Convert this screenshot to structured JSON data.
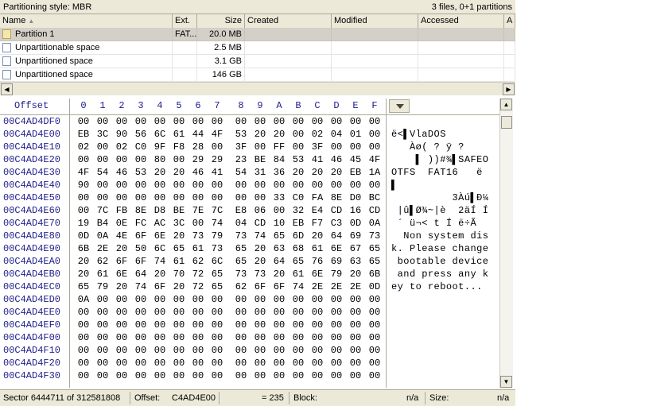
{
  "topbar": {
    "partition_style": "Partitioning style: MBR",
    "summary": "3 files, 0+1 partitions"
  },
  "file_list": {
    "columns": [
      "Name",
      "Ext.",
      "Size",
      "Created",
      "Modified",
      "Accessed",
      "A"
    ],
    "rows": [
      {
        "name": "Partition 1",
        "ext": "FAT...",
        "size": "20.0 MB",
        "icon": "partition-icon",
        "selected": true
      },
      {
        "name": "Unpartitionable space",
        "ext": "",
        "size": "2.5 MB",
        "icon": "document-icon",
        "selected": false
      },
      {
        "name": "Unpartitioned space",
        "ext": "",
        "size": "3.1 GB",
        "icon": "document-icon",
        "selected": false
      },
      {
        "name": "Unpartitioned space",
        "ext": "",
        "size": "146 GB",
        "icon": "document-icon",
        "selected": false
      }
    ]
  },
  "hex_view": {
    "offset_label": "Offset",
    "column_labels": [
      "0",
      "1",
      "2",
      "3",
      "4",
      "5",
      "6",
      "7",
      "8",
      "9",
      "A",
      "B",
      "C",
      "D",
      "E",
      "F"
    ],
    "rows": [
      {
        "offset": "00C4AD4DF0",
        "bytes": [
          "00",
          "00",
          "00",
          "00",
          "00",
          "00",
          "00",
          "00",
          "00",
          "00",
          "00",
          "00",
          "00",
          "00",
          "00",
          "00"
        ],
        "text": ""
      },
      {
        "offset": "00C4AD4E00",
        "bytes": [
          "EB",
          "3C",
          "90",
          "56",
          "6C",
          "61",
          "44",
          "4F",
          "53",
          "20",
          "20",
          "00",
          "02",
          "04",
          "01",
          "00"
        ],
        "text": "ë<▌VlaDOS"
      },
      {
        "offset": "00C4AD4E10",
        "bytes": [
          "02",
          "00",
          "02",
          "C0",
          "9F",
          "F8",
          "28",
          "00",
          "3F",
          "00",
          "FF",
          "00",
          "3F",
          "00",
          "00",
          "00"
        ],
        "text": "   Àø( ? ÿ ?"
      },
      {
        "offset": "00C4AD4E20",
        "bytes": [
          "00",
          "00",
          "00",
          "00",
          "80",
          "00",
          "29",
          "29",
          "23",
          "BE",
          "84",
          "53",
          "41",
          "46",
          "45",
          "4F"
        ],
        "text": "    ▌ ))#¾▌SAFEO"
      },
      {
        "offset": "00C4AD4E30",
        "bytes": [
          "4F",
          "54",
          "46",
          "53",
          "20",
          "20",
          "46",
          "41",
          "54",
          "31",
          "36",
          "20",
          "20",
          "20",
          "EB",
          "1A"
        ],
        "text": "OTFS  FAT16   ë"
      },
      {
        "offset": "00C4AD4E40",
        "bytes": [
          "90",
          "00",
          "00",
          "00",
          "00",
          "00",
          "00",
          "00",
          "00",
          "00",
          "00",
          "00",
          "00",
          "00",
          "00",
          "00"
        ],
        "text": "▌"
      },
      {
        "offset": "00C4AD4E50",
        "bytes": [
          "00",
          "00",
          "00",
          "00",
          "00",
          "00",
          "00",
          "00",
          "00",
          "00",
          "33",
          "C0",
          "FA",
          "8E",
          "D0",
          "BC"
        ],
        "text": "          3Àú▌Ð¼"
      },
      {
        "offset": "00C4AD4E60",
        "bytes": [
          "00",
          "7C",
          "FB",
          "8E",
          "D8",
          "BE",
          "7E",
          "7C",
          "E8",
          "06",
          "00",
          "32",
          "E4",
          "CD",
          "16",
          "CD"
        ],
        "text": " |û▌Ø¾~|è  2äÍ Í"
      },
      {
        "offset": "00C4AD4E70",
        "bytes": [
          "19",
          "B4",
          "0E",
          "FC",
          "AC",
          "3C",
          "00",
          "74",
          "04",
          "CD",
          "10",
          "EB",
          "F7",
          "C3",
          "0D",
          "0A"
        ],
        "text": " ´ ü¬< t Í ë÷Ã"
      },
      {
        "offset": "00C4AD4E80",
        "bytes": [
          "0D",
          "0A",
          "4E",
          "6F",
          "6E",
          "20",
          "73",
          "79",
          "73",
          "74",
          "65",
          "6D",
          "20",
          "64",
          "69",
          "73"
        ],
        "text": "  Non system dis"
      },
      {
        "offset": "00C4AD4E90",
        "bytes": [
          "6B",
          "2E",
          "20",
          "50",
          "6C",
          "65",
          "61",
          "73",
          "65",
          "20",
          "63",
          "68",
          "61",
          "6E",
          "67",
          "65"
        ],
        "text": "k. Please change"
      },
      {
        "offset": "00C4AD4EA0",
        "bytes": [
          "20",
          "62",
          "6F",
          "6F",
          "74",
          "61",
          "62",
          "6C",
          "65",
          "20",
          "64",
          "65",
          "76",
          "69",
          "63",
          "65"
        ],
        "text": " bootable device"
      },
      {
        "offset": "00C4AD4EB0",
        "bytes": [
          "20",
          "61",
          "6E",
          "64",
          "20",
          "70",
          "72",
          "65",
          "73",
          "73",
          "20",
          "61",
          "6E",
          "79",
          "20",
          "6B"
        ],
        "text": " and press any k"
      },
      {
        "offset": "00C4AD4EC0",
        "bytes": [
          "65",
          "79",
          "20",
          "74",
          "6F",
          "20",
          "72",
          "65",
          "62",
          "6F",
          "6F",
          "74",
          "2E",
          "2E",
          "2E",
          "0D"
        ],
        "text": "ey to reboot..."
      },
      {
        "offset": "00C4AD4ED0",
        "bytes": [
          "0A",
          "00",
          "00",
          "00",
          "00",
          "00",
          "00",
          "00",
          "00",
          "00",
          "00",
          "00",
          "00",
          "00",
          "00",
          "00"
        ],
        "text": ""
      },
      {
        "offset": "00C4AD4EE0",
        "bytes": [
          "00",
          "00",
          "00",
          "00",
          "00",
          "00",
          "00",
          "00",
          "00",
          "00",
          "00",
          "00",
          "00",
          "00",
          "00",
          "00"
        ],
        "text": ""
      },
      {
        "offset": "00C4AD4EF0",
        "bytes": [
          "00",
          "00",
          "00",
          "00",
          "00",
          "00",
          "00",
          "00",
          "00",
          "00",
          "00",
          "00",
          "00",
          "00",
          "00",
          "00"
        ],
        "text": ""
      },
      {
        "offset": "00C4AD4F00",
        "bytes": [
          "00",
          "00",
          "00",
          "00",
          "00",
          "00",
          "00",
          "00",
          "00",
          "00",
          "00",
          "00",
          "00",
          "00",
          "00",
          "00"
        ],
        "text": ""
      },
      {
        "offset": "00C4AD4F10",
        "bytes": [
          "00",
          "00",
          "00",
          "00",
          "00",
          "00",
          "00",
          "00",
          "00",
          "00",
          "00",
          "00",
          "00",
          "00",
          "00",
          "00"
        ],
        "text": ""
      },
      {
        "offset": "00C4AD4F20",
        "bytes": [
          "00",
          "00",
          "00",
          "00",
          "00",
          "00",
          "00",
          "00",
          "00",
          "00",
          "00",
          "00",
          "00",
          "00",
          "00",
          "00"
        ],
        "text": ""
      },
      {
        "offset": "00C4AD4F30",
        "bytes": [
          "00",
          "00",
          "00",
          "00",
          "00",
          "00",
          "00",
          "00",
          "00",
          "00",
          "00",
          "00",
          "00",
          "00",
          "00",
          "00"
        ],
        "text": ""
      }
    ]
  },
  "statusbar": {
    "sector": "Sector 6444711 of 312581808",
    "offset_label": "Offset:",
    "offset_value": "C4AD4E00",
    "value": "= 235",
    "block_label": "Block:",
    "block_value": "n/a",
    "size_label": "Size:",
    "size_value": "n/a"
  },
  "colors": {
    "chrome": "#ece9d8",
    "offset_text": "#20208c",
    "selected_row": "#d4d0c8"
  }
}
